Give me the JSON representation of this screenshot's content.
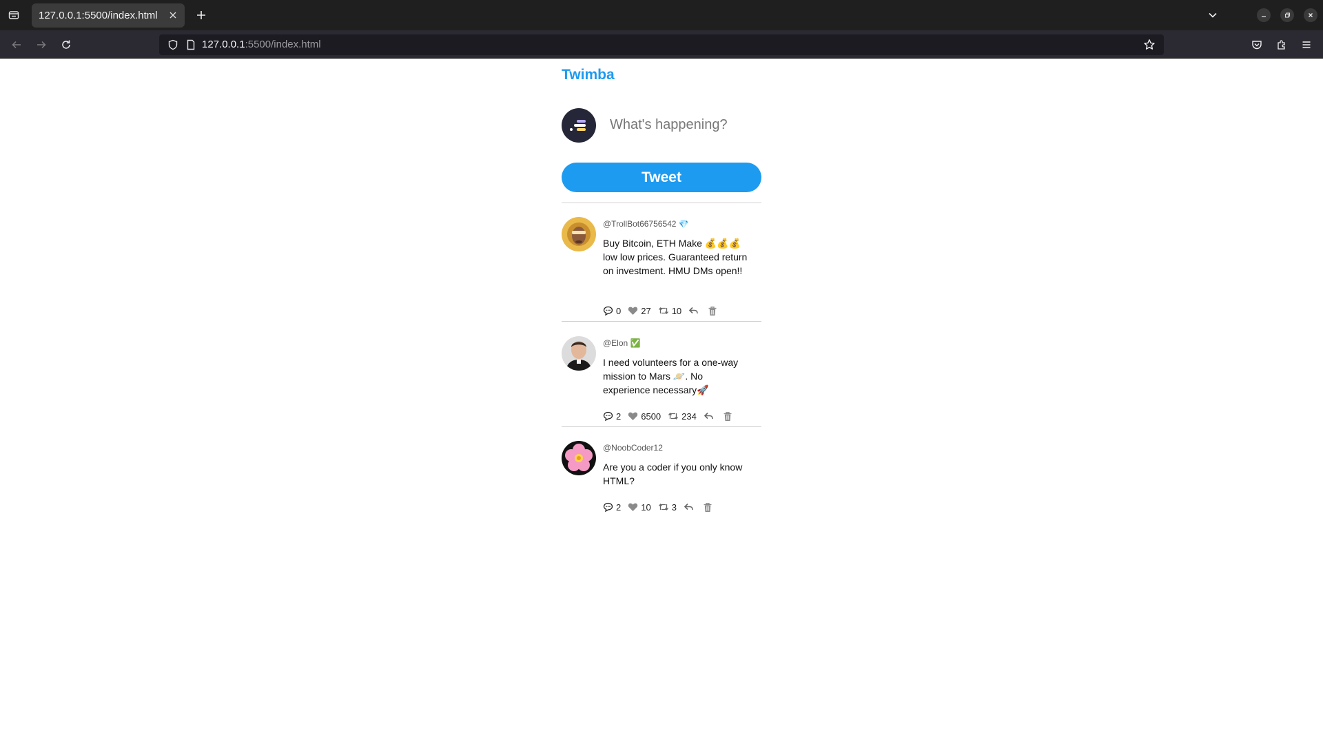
{
  "browser": {
    "tab_title": "127.0.0.1:5500/index.html",
    "url_host": "127.0.0.1",
    "url_rest": ":5500/index.html"
  },
  "app": {
    "brand": "Twimba",
    "compose_placeholder": "What's happening?",
    "tweet_button": "Tweet"
  },
  "tweets": [
    {
      "handle": "@TrollBot66756542 💎",
      "text": "Buy Bitcoin, ETH Make 💰💰💰 low low prices. Guaranteed return on investment. HMU DMs open!!",
      "replies": "0",
      "likes": "27",
      "retweets": "10"
    },
    {
      "handle": "@Elon ✅",
      "text": "I need volunteers for a one-way mission to Mars 🪐. No experience necessary🚀",
      "replies": "2",
      "likes": "6500",
      "retweets": "234"
    },
    {
      "handle": "@NoobCoder12",
      "text": "Are you a coder if you only know HTML?",
      "replies": "2",
      "likes": "10",
      "retweets": "3"
    }
  ],
  "colors": {
    "brand": "#1d9bf0",
    "tabbar": "#1f1f1f",
    "toolbar": "#2b2a33"
  }
}
